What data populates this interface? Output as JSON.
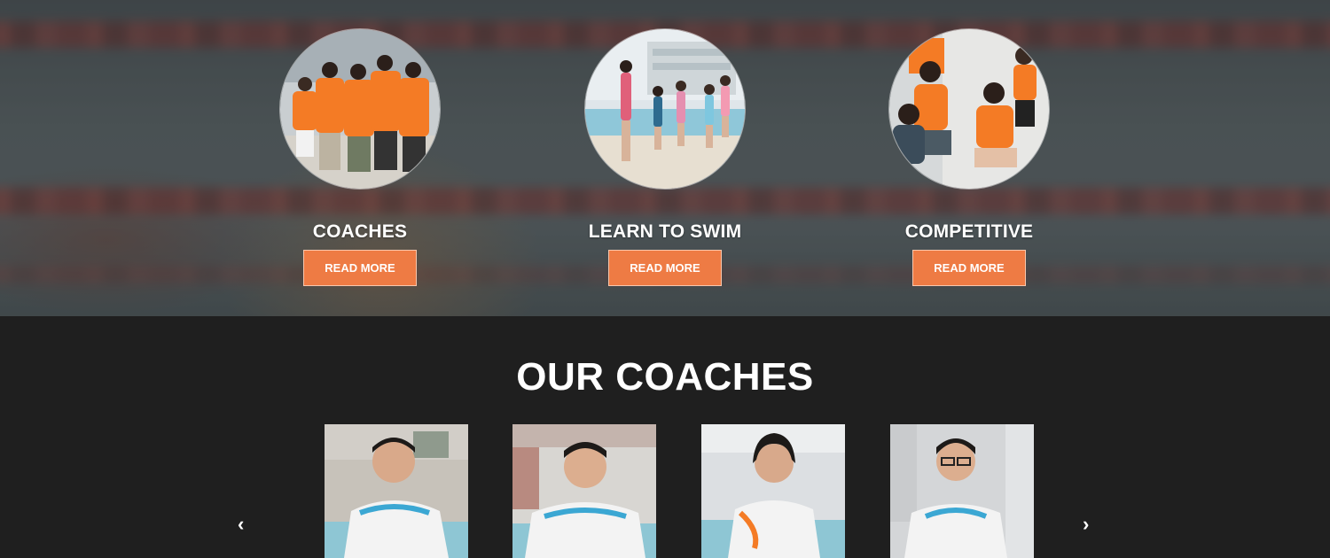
{
  "features": [
    {
      "title": "COACHES",
      "button_label": "READ MORE"
    },
    {
      "title": "LEARN TO SWIM",
      "button_label": "READ MORE"
    },
    {
      "title": "COMPETITIVE",
      "button_label": "READ MORE"
    }
  ],
  "coaches_section": {
    "title": "OUR COACHES",
    "prev_arrow": "‹",
    "next_arrow": "›",
    "coach_photos": [
      "coach-photo-1",
      "coach-photo-2",
      "coach-photo-3",
      "coach-photo-4"
    ]
  },
  "colors": {
    "accent": "#ee7b44",
    "dark_bg": "#1f1f1f",
    "shirt_orange": "#f47b25"
  }
}
